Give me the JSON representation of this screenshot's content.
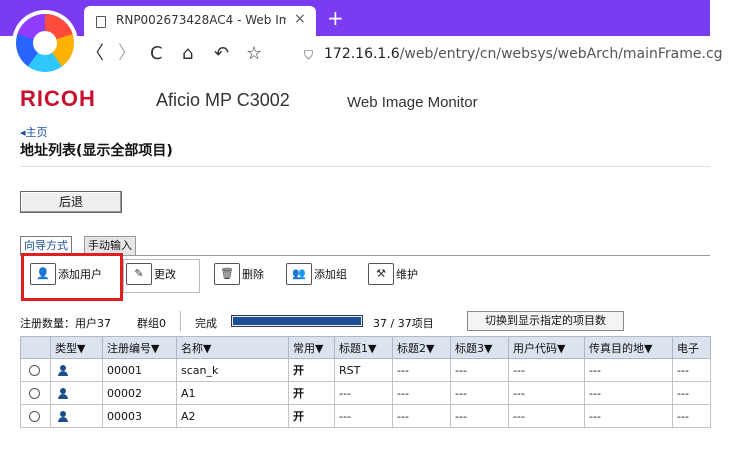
{
  "browser": {
    "tab_title": "RNP002673428AC4 - Web Im",
    "tab_close": "×",
    "new_tab": "+",
    "nav": {
      "back": "〈",
      "forward": "〉",
      "reload": "C",
      "home": "⌂",
      "undo": "↶",
      "star": "☆"
    },
    "url_host": "172.16.1.6",
    "url_path": "/web/entry/cn/websys/webArch/mainFrame.cg"
  },
  "header": {
    "brand": "RICOH",
    "model": "Aficio MP C3002",
    "app": "Web Image Monitor"
  },
  "nav": {
    "home_link": "◂主页"
  },
  "page": {
    "heading": "地址列表(显示全部项目)",
    "back_button": "后退",
    "tabs": [
      "向导方式",
      "手动输入"
    ]
  },
  "toolbar": {
    "add_user": "添加用户",
    "change": "更改",
    "delete": "删除",
    "add_group": "添加组",
    "maintain": "维护"
  },
  "status": {
    "registered": "注册数量：用户37",
    "groups": "群组0",
    "done": "完成",
    "progress": "37 / 37项目",
    "progress_fraction": 1.0,
    "switch_button": "切换到显示指定的项目数"
  },
  "table": {
    "headers": [
      "",
      "类型▼",
      "注册编号▼",
      "名称▼",
      "常用▼",
      "标题1▼",
      "标题2▼",
      "标题3▼",
      "用户代码▼",
      "传真目的地▼",
      "电子"
    ],
    "rows": [
      {
        "number": "00001",
        "name": "scan_k",
        "frequent": "开",
        "title1": "RST",
        "title2": "---",
        "title3": "---",
        "user_code": "---",
        "fax": "---",
        "email": "---"
      },
      {
        "number": "00002",
        "name": "A1",
        "frequent": "开",
        "title1": "---",
        "title2": "---",
        "title3": "---",
        "user_code": "---",
        "fax": "---",
        "email": "---"
      },
      {
        "number": "00003",
        "name": "A2",
        "frequent": "开",
        "title1": "---",
        "title2": "---",
        "title3": "---",
        "user_code": "---",
        "fax": "---",
        "email": "---"
      }
    ]
  },
  "colors": {
    "browser_accent": "#7a3cf0",
    "brand_red": "#c8102e",
    "highlight": "#e02020",
    "progress": "#1d4f96"
  }
}
